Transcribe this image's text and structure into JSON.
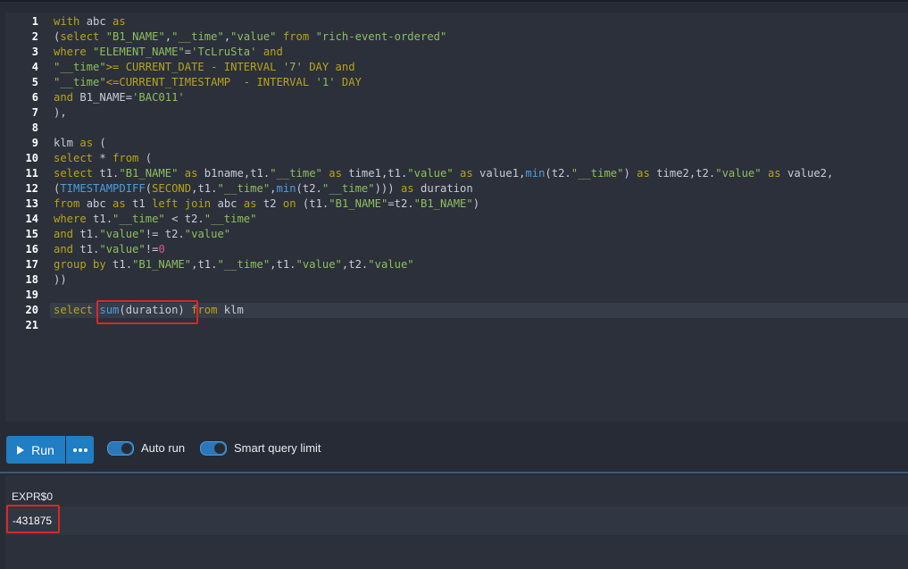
{
  "editor": {
    "line_numbers": [
      "1",
      "2",
      "3",
      "4",
      "5",
      "6",
      "7",
      "8",
      "9",
      "10",
      "11",
      "12",
      "13",
      "14",
      "15",
      "16",
      "17",
      "18",
      "19",
      "20",
      "21"
    ],
    "active_line": "20"
  },
  "toolbar": {
    "run_label": "Run",
    "more_icon": "ellipsis-icon",
    "auto_run_label": "Auto run",
    "auto_run_enabled": true,
    "smart_limit_label": "Smart query limit",
    "smart_limit_enabled": true
  },
  "results": {
    "column_header": "EXPR$0",
    "rows": [
      [
        "-431875"
      ]
    ]
  },
  "colors": {
    "keyword": "#b8a417",
    "string": "#8fbf5c",
    "function": "#4a9fe0",
    "number": "#d9558f",
    "highlight_box": "#e02525",
    "run_button": "#1f7ec4"
  }
}
